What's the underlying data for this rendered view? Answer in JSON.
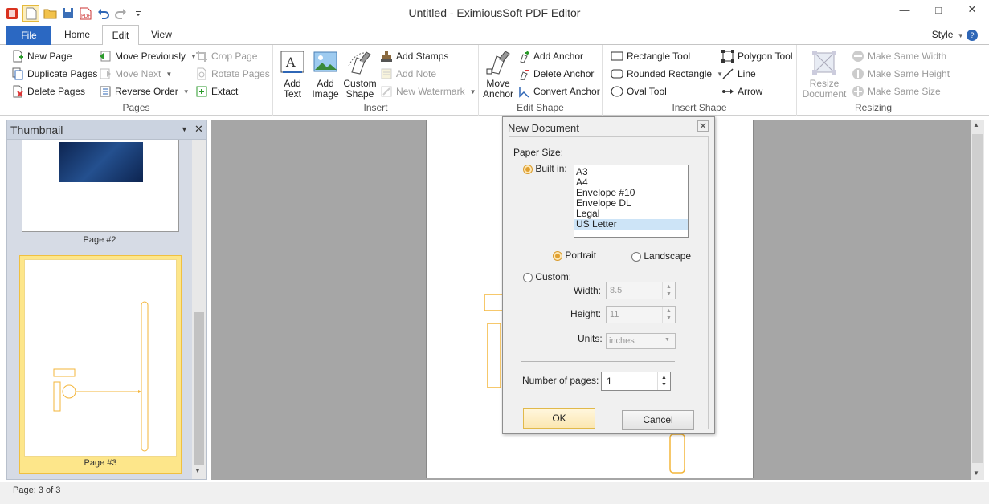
{
  "window": {
    "title": "Untitled - EximiousSoft PDF Editor"
  },
  "tabs": {
    "file": "File",
    "home": "Home",
    "edit": "Edit",
    "view": "View",
    "style": "Style"
  },
  "ribbon": {
    "pages": {
      "caption": "Pages",
      "new_page": "New Page",
      "duplicate_pages": "Duplicate Pages",
      "delete_pages": "Delete Pages",
      "move_previously": "Move Previously",
      "move_next": "Move Next",
      "reverse_order": "Reverse Order",
      "crop_page": "Crop Page",
      "rotate_pages": "Rotate Pages",
      "extract": "Extact"
    },
    "insert": {
      "caption": "Insert",
      "add_text_1": "Add",
      "add_text_2": "Text",
      "add_image_1": "Add",
      "add_image_2": "Image",
      "custom_shape_1": "Custom",
      "custom_shape_2": "Shape",
      "add_stamps": "Add Stamps",
      "add_note": "Add Note",
      "new_watermark": "New Watermark"
    },
    "edit_shape": {
      "caption": "Edit Shape",
      "move_anchor_1": "Move",
      "move_anchor_2": "Anchor",
      "add_anchor": "Add Anchor",
      "delete_anchor": "Delete Anchor",
      "convert_anchor": "Convert Anchor"
    },
    "insert_shape": {
      "caption": "Insert Shape",
      "rectangle": "Rectangle Tool",
      "rounded_rectangle": "Rounded Rectangle",
      "oval": "Oval Tool",
      "polygon": "Polygon Tool",
      "line": "Line",
      "arrow": "Arrow"
    },
    "resizing": {
      "caption": "Resizing",
      "resize_doc_1": "Resize",
      "resize_doc_2": "Document",
      "same_width": "Make Same Width",
      "same_height": "Make Same Height",
      "same_size": "Make Same Size"
    }
  },
  "thumbnail": {
    "title": "Thumbnail",
    "page2": "Page #2",
    "page3": "Page #3"
  },
  "status": {
    "text": "Page: 3 of 3"
  },
  "dialog": {
    "title": "New Document",
    "paper_size": "Paper Size:",
    "built_in": "Built in:",
    "sizes": [
      "A3",
      "A4",
      "Envelope #10",
      "Envelope DL",
      "Legal",
      "US Letter"
    ],
    "portrait": "Portrait",
    "landscape": "Landscape",
    "custom": "Custom:",
    "width_label": "Width:",
    "width_value": "8.5",
    "height_label": "Height:",
    "height_value": "11",
    "units_label": "Units:",
    "units_value": "inches",
    "pages_label": "Number of pages:",
    "pages_value": "1",
    "ok": "OK",
    "cancel": "Cancel"
  },
  "colors": {
    "file_tab": "#2b68c2",
    "accent": "#f3c33c",
    "shape": "#f3b53a"
  }
}
